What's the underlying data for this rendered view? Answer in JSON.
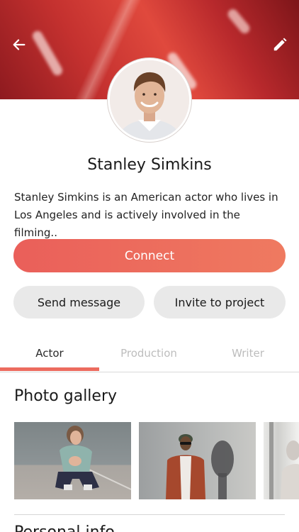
{
  "profile": {
    "name": "Stanley Simkins",
    "bio": "Stanley Simkins is an American actor who lives in Los Angeles and is actively involved in the filming.."
  },
  "actions": {
    "connect_label": "Connect",
    "message_label": "Send message",
    "invite_label": "Invite to project"
  },
  "tabs": [
    {
      "label": "Actor",
      "active": true
    },
    {
      "label": "Production",
      "active": false
    },
    {
      "label": "Writer",
      "active": false
    }
  ],
  "sections": {
    "gallery_title": "Photo gallery",
    "next_title": "Personal info"
  },
  "icons": {
    "back": "arrow-left-icon",
    "edit": "pencil-icon"
  },
  "colors": {
    "accent": "#ec6b5e",
    "connect_start": "#ea5f5a",
    "connect_end": "#ef7a60",
    "secondary_button": "#e9e9e9",
    "inactive_tab": "#bdbdbd"
  }
}
